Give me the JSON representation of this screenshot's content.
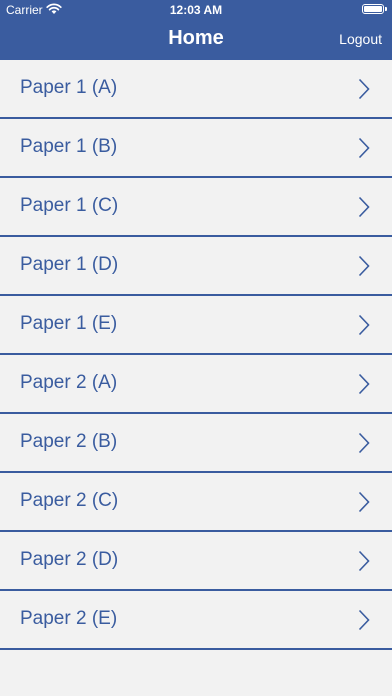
{
  "status_bar": {
    "carrier": "Carrier",
    "time": "12:03 AM"
  },
  "header": {
    "title": "Home",
    "logout_label": "Logout"
  },
  "colors": {
    "accent": "#3a5c9f",
    "background": "#f2f2f2"
  },
  "list": {
    "items": [
      {
        "label": "Paper 1 (A)"
      },
      {
        "label": "Paper 1 (B)"
      },
      {
        "label": "Paper 1 (C)"
      },
      {
        "label": "Paper 1 (D)"
      },
      {
        "label": "Paper 1 (E)"
      },
      {
        "label": "Paper 2 (A)"
      },
      {
        "label": "Paper 2 (B)"
      },
      {
        "label": "Paper 2 (C)"
      },
      {
        "label": "Paper 2 (D)"
      },
      {
        "label": "Paper 2 (E)"
      }
    ]
  }
}
